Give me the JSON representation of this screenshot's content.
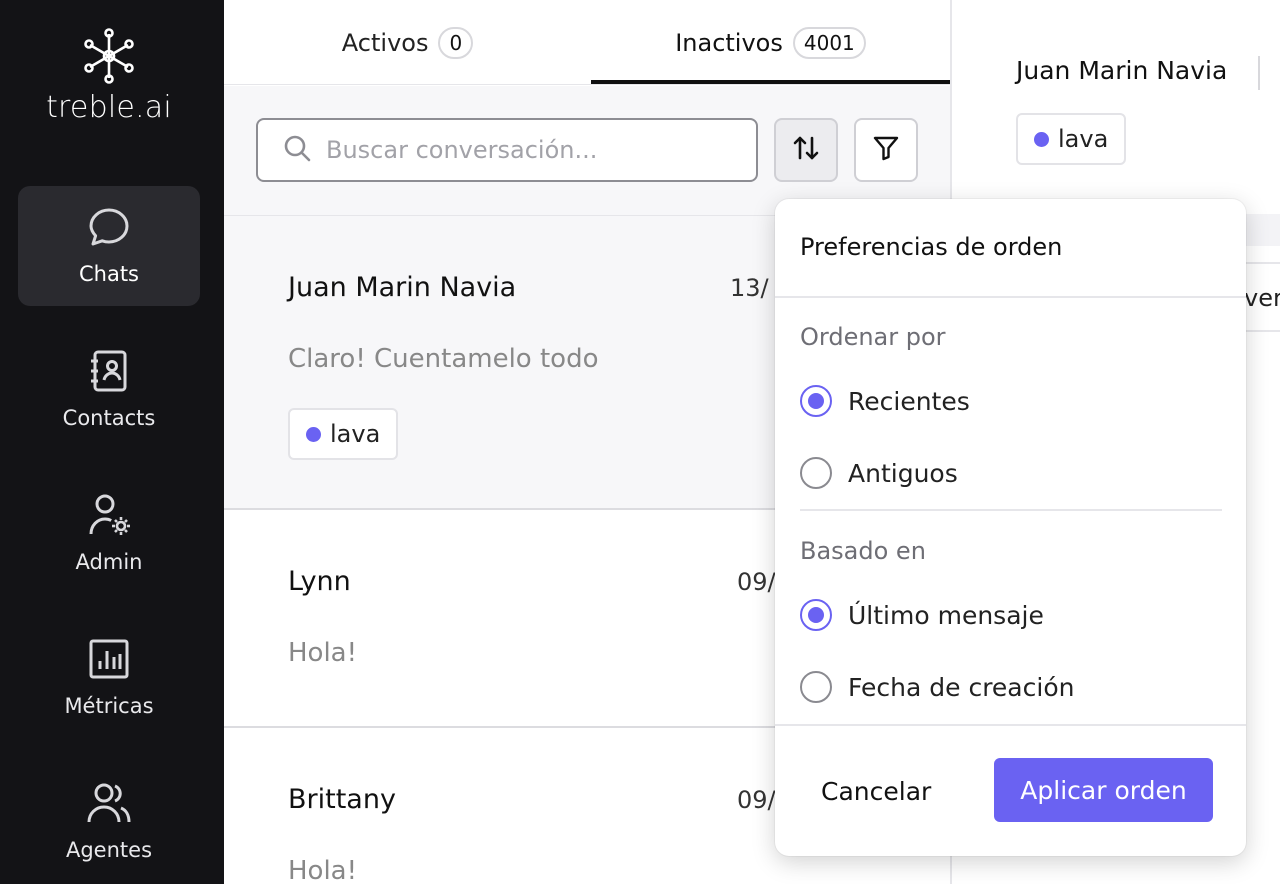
{
  "brand": {
    "name": "treble.ai",
    "logo_icon": "network-logo-icon"
  },
  "sidebar": {
    "items": [
      {
        "label": "Chats",
        "icon": "chat-bubble-icon",
        "active": true
      },
      {
        "label": "Contacts",
        "icon": "contact-card-icon"
      },
      {
        "label": "Admin",
        "icon": "user-gear-icon"
      },
      {
        "label": "Métricas",
        "icon": "bar-chart-icon"
      },
      {
        "label": "Agentes",
        "icon": "users-icon"
      }
    ]
  },
  "tabs": [
    {
      "label": "Activos",
      "count": "0"
    },
    {
      "label": "Inactivos",
      "count": "4001",
      "active": true
    }
  ],
  "search": {
    "placeholder": "Buscar conversación...",
    "value": ""
  },
  "toolbar": {
    "sort_icon": "sort-arrows-icon",
    "filter_icon": "filter-funnel-icon"
  },
  "conversations": [
    {
      "name": "Juan Marin Navia",
      "date": "13/",
      "message": "Claro! Cuentamelo todo",
      "tag": "lava",
      "selected": true
    },
    {
      "name": "Lynn",
      "date": "09/",
      "message": "Hola!"
    },
    {
      "name": "Brittany",
      "date": "09/",
      "message": "Hola!"
    }
  ],
  "detail": {
    "name": "Juan Marin Navia",
    "tag": "lava",
    "fragment": "vers"
  },
  "sort_popover": {
    "title": "Preferencias de orden",
    "order_by_label": "Ordenar por",
    "order_options": [
      "Recientes",
      "Antiguos"
    ],
    "order_selected": "Recientes",
    "based_on_label": "Basado en",
    "based_options": [
      "Último mensaje",
      "Fecha de creación"
    ],
    "based_selected": "Último mensaje",
    "cancel_label": "Cancelar",
    "apply_label": "Aplicar orden"
  },
  "colors": {
    "sidebar_bg": "#131316",
    "accent": "#6a62f2",
    "tag_dot": "#6a62f2"
  }
}
